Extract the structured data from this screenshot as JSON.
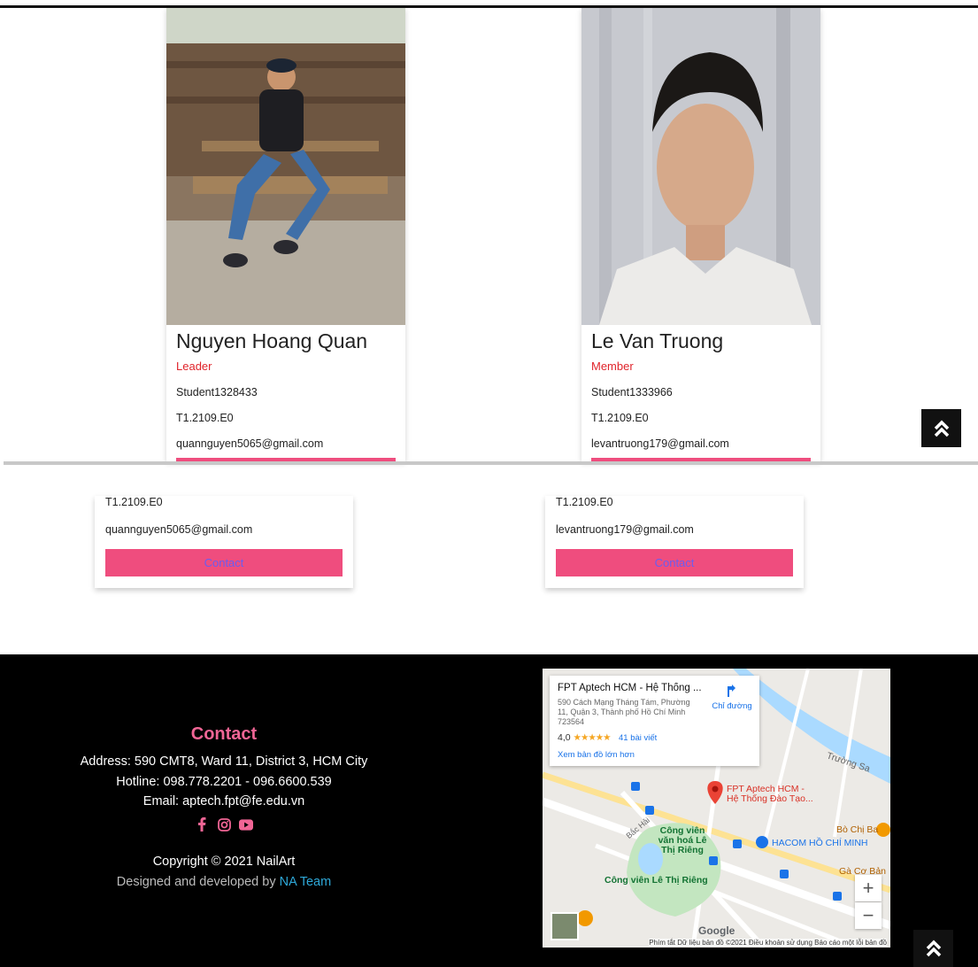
{
  "members_top": [
    {
      "name": "Nguyen Hoang Quan",
      "role": "Leader",
      "student_id": "Student1328433",
      "class": "T1.2109.E0",
      "email": "quannguyen5065@gmail.com"
    },
    {
      "name": "Le Van Truong",
      "role": "Member",
      "student_id": "Student1333966",
      "class": "T1.2109.E0",
      "email": "levantruong179@gmail.com"
    }
  ],
  "members_bottom": [
    {
      "class": "T1.2109.E0",
      "email": "quannguyen5065@gmail.com",
      "button": "Contact"
    },
    {
      "class": "T1.2109.E0",
      "email": "levantruong179@gmail.com",
      "button": "Contact"
    }
  ],
  "footer": {
    "title": "Contact",
    "address": "Address: 590 CMT8, Ward 11, District 3, HCM City",
    "hotline": "Hotline: 098.778.2201 - 096.6600.539",
    "email": "Email: aptech.fpt@fe.edu.vn",
    "socials": [
      "facebook-icon",
      "instagram-icon",
      "youtube-icon"
    ],
    "copyright": "Copyright © 2021 NailArt",
    "designed_prefix": "Designed and developed by ",
    "team": "NA Team"
  },
  "map": {
    "place_title": "FPT Aptech HCM - Hệ Thống ...",
    "place_address": "590 Cách Mạng Tháng Tám, Phường 11, Quận 3, Thành phố Hồ Chí Minh 723564",
    "rating": "4,0",
    "stars": "★★★★★",
    "reviews": "41 bài viết",
    "bigger_map": "Xem bản đồ lớn hơn",
    "directions": "Chỉ đường",
    "pin_label": "FPT Aptech HCM - Hệ Thống Đào Tạo...",
    "park_label": "Công viên văn hoá Lê Thị Riêng",
    "park_label2": "Công viên Lê Thị Riêng",
    "hacom": "HACOM HỒ CHÍ MINH",
    "bo_chi_ba": "Bò Chị Ba",
    "ga_co_ban": "Gà Cơ Bản",
    "truong_sa": "Trường Sa",
    "bac_hai": "Bắc Hải",
    "google": "Google",
    "footer_text": "Phím tắt   Dữ liệu bản đồ ©2021   Điều khoản sử dụng   Báo cáo một lỗi bản đồ",
    "zoom_in": "+",
    "zoom_out": "−"
  },
  "colors": {
    "accent": "#ef4d7e",
    "role": "#e0242b",
    "team": "#2ea8d8",
    "footer_bg": "#000000"
  }
}
